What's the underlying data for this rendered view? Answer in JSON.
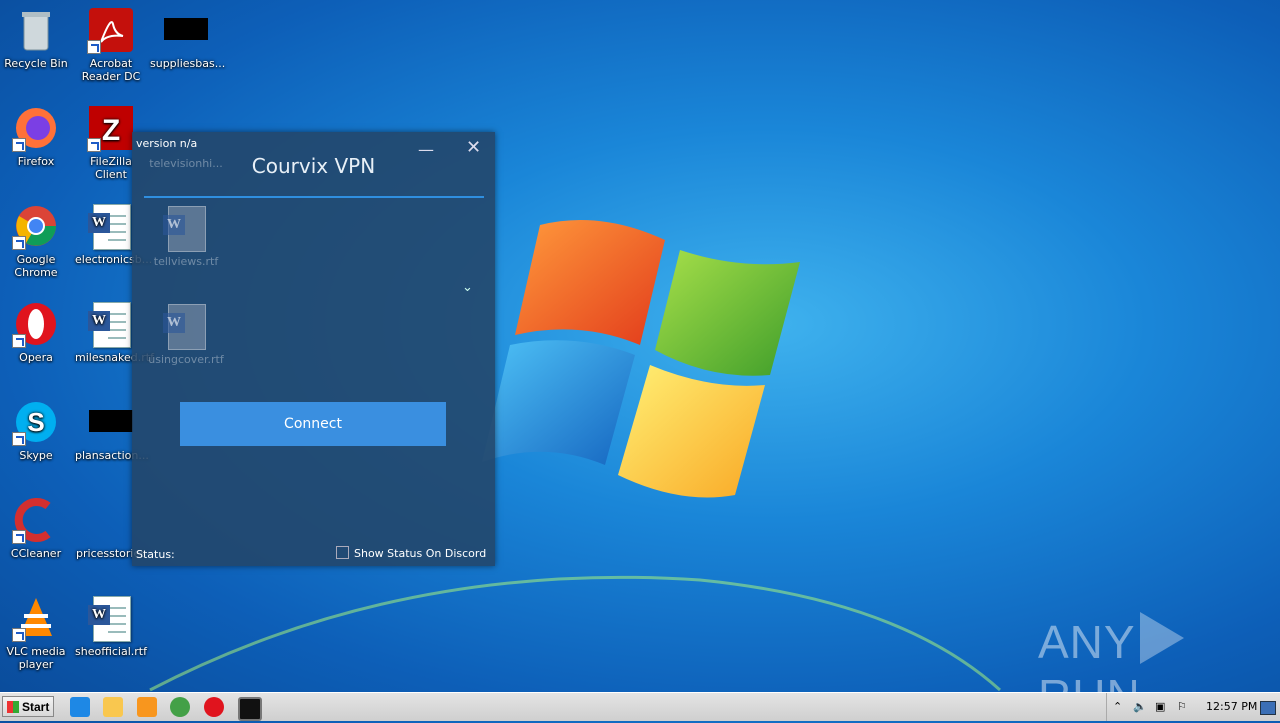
{
  "desktop": {
    "icons": [
      {
        "label": "Recycle Bin"
      },
      {
        "label": "Acrobat Reader DC"
      },
      {
        "label": "suppliesbas..."
      },
      {
        "label": "Firefox"
      },
      {
        "label": "FileZilla Client"
      },
      {
        "label": "televisionhi..."
      },
      {
        "label": "Google Chrome"
      },
      {
        "label": "electronicsb..."
      },
      {
        "label": "tellviews.rtf"
      },
      {
        "label": "Opera"
      },
      {
        "label": "milesnaked.rtf"
      },
      {
        "label": "usingcover.rtf"
      },
      {
        "label": "Skype"
      },
      {
        "label": "plansaction..."
      },
      {
        "label": "CCleaner"
      },
      {
        "label": "pricesstories"
      },
      {
        "label": "VLC media player"
      },
      {
        "label": "sheofficial.rtf"
      }
    ]
  },
  "vpn": {
    "title": "Courvix VPN",
    "version": "version n/a",
    "minimize": "—",
    "close": "✕",
    "chevron": "⌄",
    "connect_label": "Connect",
    "status_label": "Status:",
    "discord_label": "Show Status On Discord"
  },
  "watermark": {
    "left": "ANY",
    "right": "RUN"
  },
  "taskbar": {
    "start_label": "Start",
    "clock": "12:57 PM"
  },
  "colors": {
    "accent": "#3a8fe0",
    "window_bg": "#234669"
  }
}
